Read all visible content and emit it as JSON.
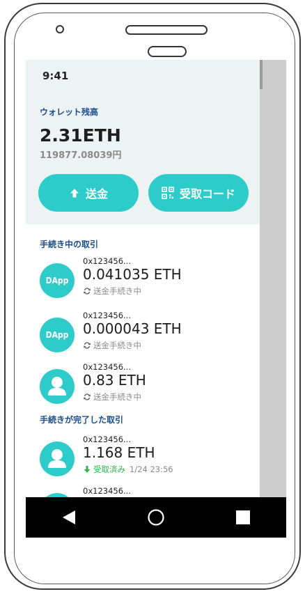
{
  "status": {
    "time": "9:41"
  },
  "wallet": {
    "label": "ウォレット残高",
    "balance": "2.31ETH",
    "balance_fiat": "119877.08039円",
    "send_label": "送金",
    "receive_label": "受取コード"
  },
  "pending": {
    "title": "手続き中の取引",
    "items": [
      {
        "address": "0x123456...",
        "amount": "0.041035 ETH",
        "status": "送金手続き中",
        "avatar": "DApp",
        "avatar_type": "dapp"
      },
      {
        "address": "0x123456...",
        "amount": "0.000043 ETH",
        "status": "送金手続き中",
        "avatar": "DApp",
        "avatar_type": "dapp"
      },
      {
        "address": "0x123456...",
        "amount": "0.83 ETH",
        "status": "送金手続き中",
        "avatar_type": "user-icon"
      }
    ]
  },
  "completed": {
    "title": "手続きが完了した取引",
    "items": [
      {
        "address": "0x123456...",
        "amount": "1.168 ETH",
        "status": "受取済み",
        "date": "1/24 23:56",
        "avatar_type": "user-icon"
      },
      {
        "address": "0x123456..."
      }
    ]
  },
  "navbar": [
    "back-icon",
    "home-icon",
    "recents-icon"
  ],
  "colors": {
    "accent": "#2ecbcb",
    "label_blue": "#1a4e8a",
    "done_green": "#2eb84a",
    "header_bg": "#edf3f2"
  }
}
